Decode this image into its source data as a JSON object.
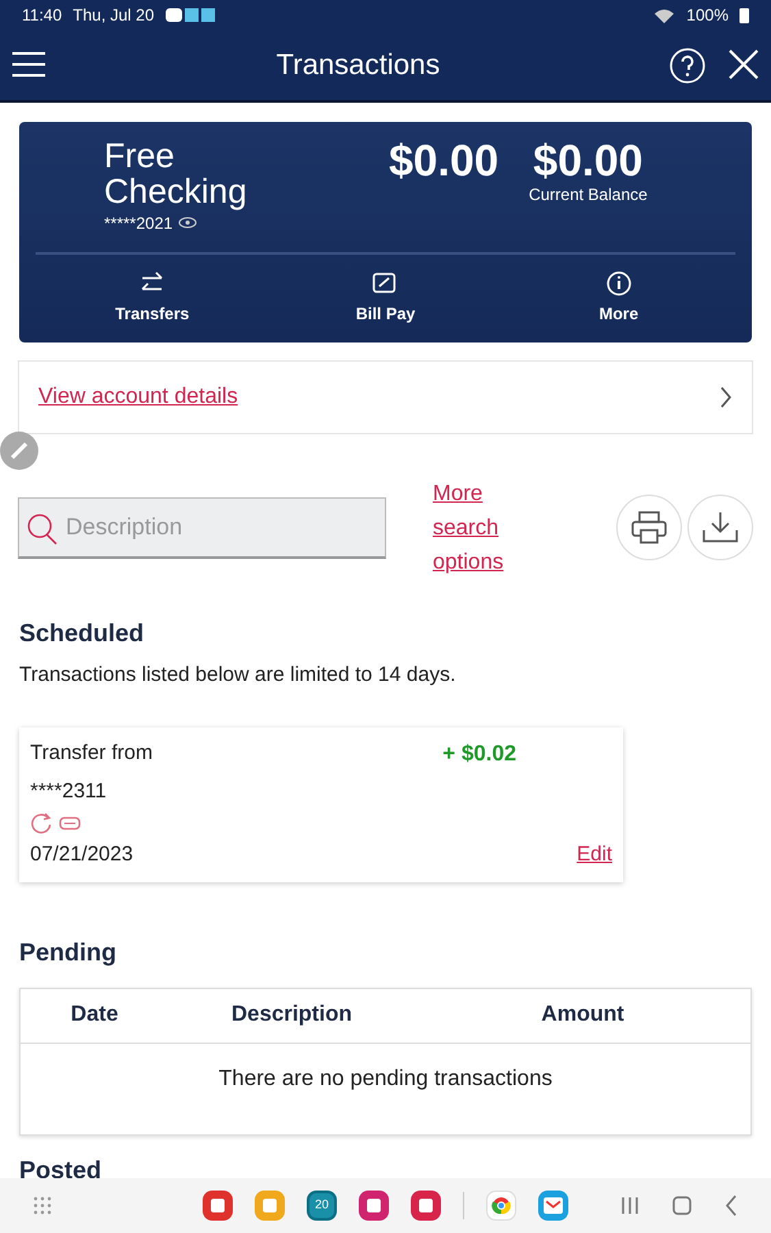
{
  "status_bar": {
    "time": "11:40",
    "date": "Thu, Jul 20",
    "battery": "100%"
  },
  "header": {
    "title": "Transactions"
  },
  "account": {
    "name": "Free Checking",
    "number": "*****2021",
    "available": "$0.00",
    "current": "$0.00",
    "current_label": "Current Balance",
    "actions": [
      {
        "kind": "transfers",
        "label": "Transfers"
      },
      {
        "kind": "billpay",
        "label": "Bill Pay"
      },
      {
        "kind": "more",
        "label": "More"
      }
    ]
  },
  "details_link": "View account details",
  "search": {
    "placeholder": "Description",
    "more_link": "More search options"
  },
  "scheduled": {
    "title": "Scheduled",
    "note": "Transactions listed below are limited to 14 days.",
    "items": [
      {
        "description": "Transfer from",
        "account": "****2311",
        "amount": "+ $0.02",
        "date": "07/21/2023",
        "action": "Edit"
      }
    ]
  },
  "pending": {
    "title": "Pending",
    "columns": [
      "Date",
      "Description",
      "Amount"
    ],
    "empty": "There are no pending transactions"
  },
  "posted": {
    "title": "Posted"
  },
  "dock": {
    "apps": [
      {
        "kind": "notes",
        "color": "#e0322c"
      },
      {
        "kind": "folder",
        "color": "#f0a81c"
      },
      {
        "kind": "calendar",
        "color": "#1a8fa8",
        "text": "20"
      },
      {
        "kind": "flower",
        "color": "#d0246e"
      },
      {
        "kind": "camera",
        "color": "#d8234a"
      },
      {
        "kind": "divider"
      },
      {
        "kind": "browser",
        "color": "#ffffff"
      },
      {
        "kind": "mail",
        "color": "#1ba0e0"
      }
    ]
  }
}
